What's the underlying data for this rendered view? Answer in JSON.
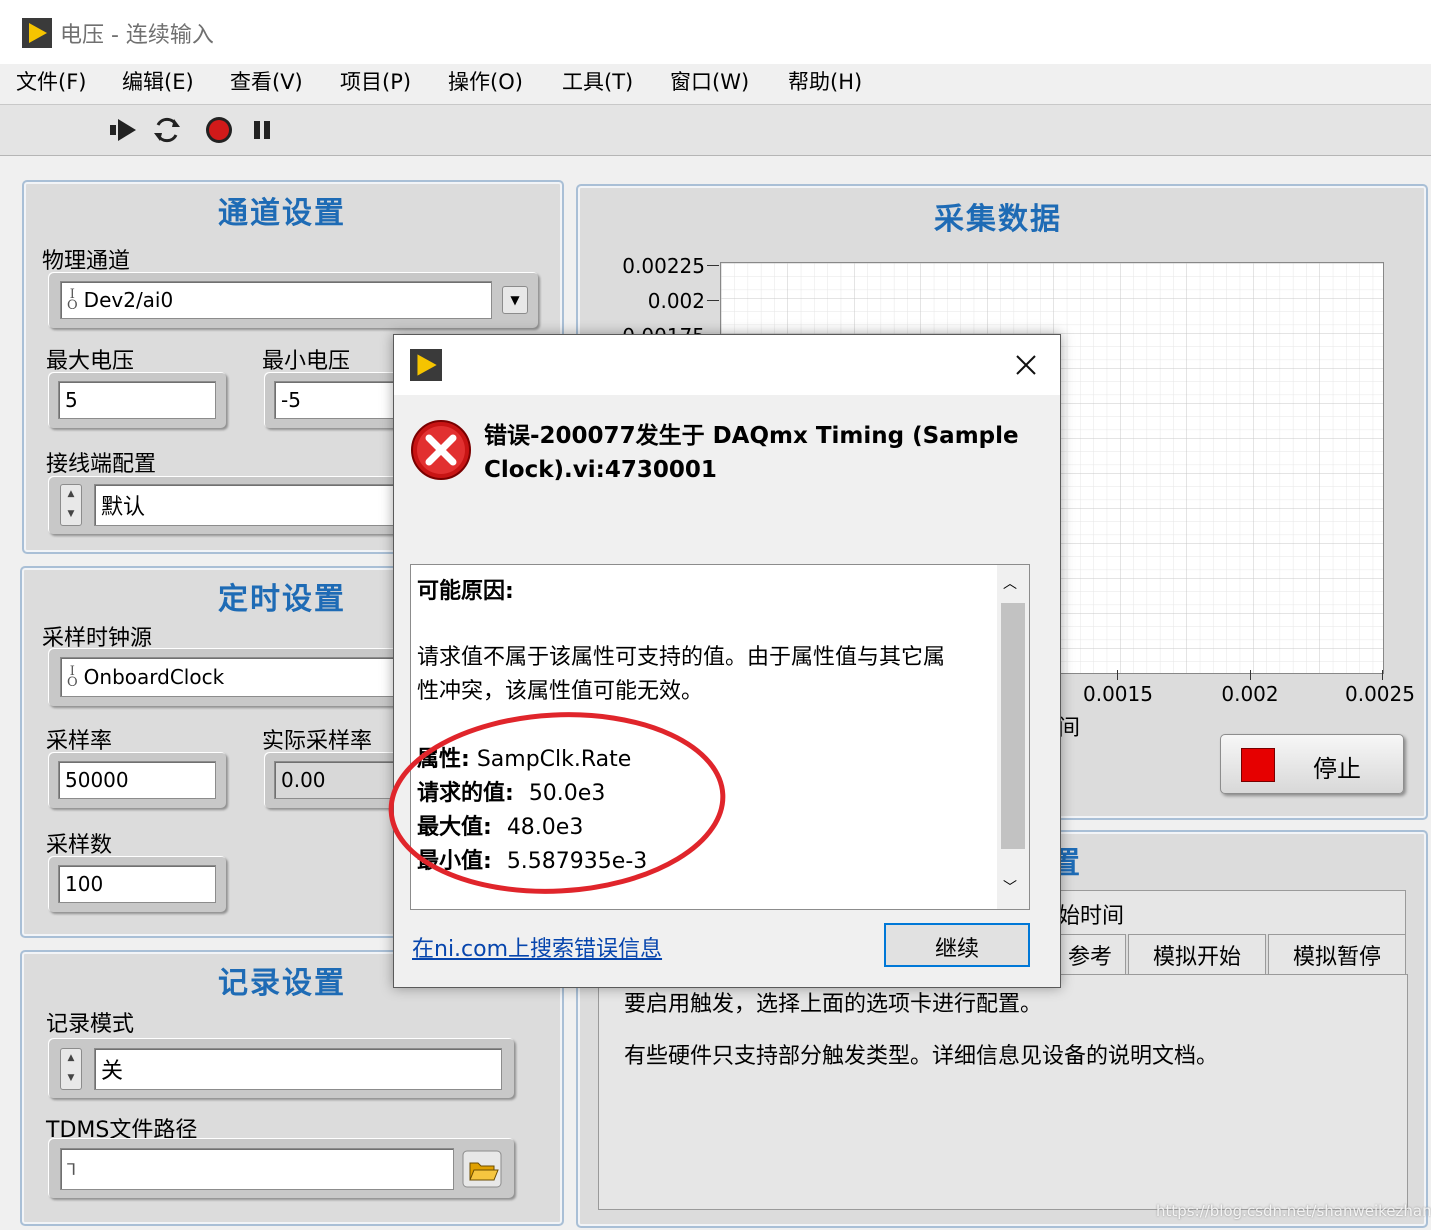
{
  "window": {
    "title": "电压 - 连续输入"
  },
  "menu": [
    "文件(F)",
    "编辑(E)",
    "查看(V)",
    "项目(P)",
    "操作(O)",
    "工具(T)",
    "窗口(W)",
    "帮助(H)"
  ],
  "toolbar": {
    "icons": [
      "run-continuous-icon",
      "run-icon",
      "abort-icon",
      "pause-icon"
    ]
  },
  "channel_panel": {
    "title": "通道设置",
    "physical_channel_label": "物理通道",
    "physical_channel_value": "Dev2/ai0",
    "max_voltage_label": "最大电压",
    "max_voltage_value": "5",
    "min_voltage_label": "最小电压",
    "min_voltage_value": "-5",
    "terminal_config_label": "接线端配置",
    "terminal_config_value": "默认"
  },
  "timing_panel": {
    "title": "定时设置",
    "clock_source_label": "采样时钟源",
    "clock_source_value": "OnboardClock",
    "rate_label": "采样率",
    "rate_value": "50000",
    "actual_rate_label": "实际采样率",
    "actual_rate_value": "0.00",
    "samples_label": "采样数",
    "samples_value": "100"
  },
  "logging_panel": {
    "title": "记录设置",
    "mode_label": "记录模式",
    "mode_value": "关",
    "path_label": "TDMS文件路径",
    "path_value": ""
  },
  "data_panel": {
    "title": "采集数据",
    "yticks": [
      "0.00225",
      "0.002",
      "0.00175"
    ],
    "xticks": [
      "0.0015",
      "0.002",
      "0.0025"
    ],
    "xlabel_fragment": "间",
    "stop_label": "停止"
  },
  "trigger_panel": {
    "title_fragment": "置",
    "tab_partial": "始时间",
    "tabs": [
      "参考",
      "模拟开始",
      "模拟暂停"
    ],
    "info1": "要启用触发，选择上面的选项卡进行配置。",
    "info2": "有些硬件只支持部分触发类型。详细信息见设备的说明文档。"
  },
  "dialog": {
    "message_line1": "错误-200077发生于 DAQmx Timing (Sample",
    "message_line2": "Clock).vi:4730001",
    "reason_header": "可能原因:",
    "reason_line1": "请求值不属于该属性可支持的值。由于属性值与其它属",
    "reason_line2": "性冲突，该属性值可能无效。",
    "property_label": "属性:",
    "property_value": "SampClk.Rate",
    "requested_label": "请求的值:",
    "requested_value": "50.0e3",
    "max_label": "最大值:",
    "max_value": "48.0e3",
    "min_label": "最小值:",
    "min_value": "5.587935e-3",
    "link": "在ni.com上搜索错误信息",
    "continue_label": "继续"
  },
  "watermark": "https://blog.csdn.net/shanweikezhang",
  "colors": {
    "panel_title": "#1e6bb5",
    "annotation_circle": "#e0252b",
    "stop_red": "#e60000"
  }
}
